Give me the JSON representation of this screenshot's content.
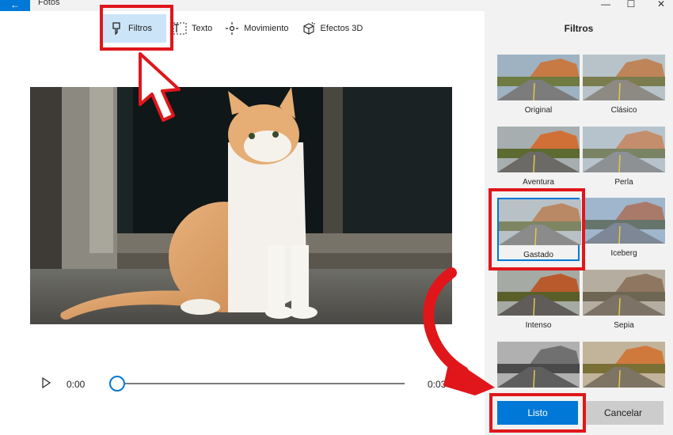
{
  "app": {
    "title": "Fotos",
    "back_glyph": "←"
  },
  "window_controls": {
    "close": "✕",
    "maximize": "☐",
    "minimize": "—"
  },
  "toolbar": [
    {
      "label": "Filtros",
      "icon": "filter-brush-icon",
      "active": true
    },
    {
      "label": "Texto",
      "icon": "text-icon",
      "active": false
    },
    {
      "label": "Movimiento",
      "icon": "motion-icon",
      "active": false
    },
    {
      "label": "Efectos 3D",
      "icon": "effects-3d-icon",
      "active": false
    }
  ],
  "player": {
    "current_time": "0:00",
    "end_time": "0:03",
    "progress": 0.0
  },
  "panel": {
    "title": "Filtros",
    "filters": [
      {
        "label": "Original",
        "style": "original"
      },
      {
        "label": "Clásico",
        "style": "clasico"
      },
      {
        "label": "Aventura",
        "style": "aventura"
      },
      {
        "label": "Perla",
        "style": "perla"
      },
      {
        "label": "Gastado",
        "style": "gastado",
        "selected": true
      },
      {
        "label": "Iceberg",
        "style": "iceberg"
      },
      {
        "label": "Intenso",
        "style": "intenso"
      },
      {
        "label": "Sepia",
        "style": "sepia"
      },
      {
        "label": "",
        "style": "bw"
      },
      {
        "label": "",
        "style": "warm"
      }
    ],
    "done_label": "Listo",
    "cancel_label": "Cancelar"
  },
  "colors": {
    "accent": "#0078d7",
    "annotation": "#e0161b"
  }
}
